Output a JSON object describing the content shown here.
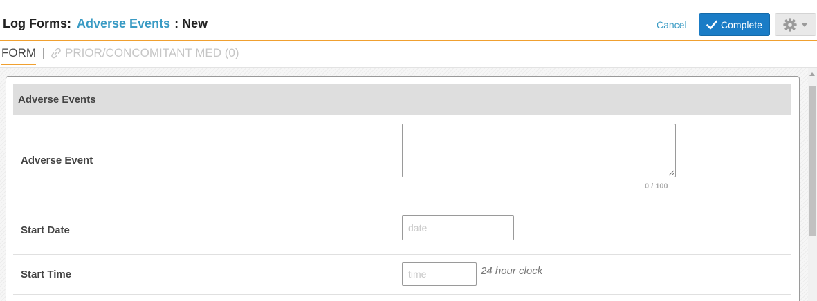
{
  "header": {
    "title_prefix": "Log Forms:",
    "title_link": "Adverse Events",
    "title_suffix": ": New",
    "cancel_label": "Cancel",
    "complete_label": "Complete",
    "accent_color": "#f0a030",
    "primary_color": "#1a7cc6"
  },
  "tabs": {
    "form_label": "FORM",
    "divider": "|",
    "prior_label": "PRIOR/CONCOMITANT MED (0)"
  },
  "section": {
    "title": "Adverse Events"
  },
  "fields": {
    "adverse_event": {
      "label": "Adverse Event",
      "value": "",
      "counter": "0 / 100"
    },
    "start_date": {
      "label": "Start Date",
      "placeholder": "date",
      "value": ""
    },
    "start_time": {
      "label": "Start Time",
      "placeholder": "time",
      "value": "",
      "hint": "24 hour clock"
    }
  },
  "icons": {
    "complete": "checkmark-icon",
    "settings": "gear-icon",
    "settings_menu": "caret-down-icon",
    "prior_link": "link-icon"
  }
}
